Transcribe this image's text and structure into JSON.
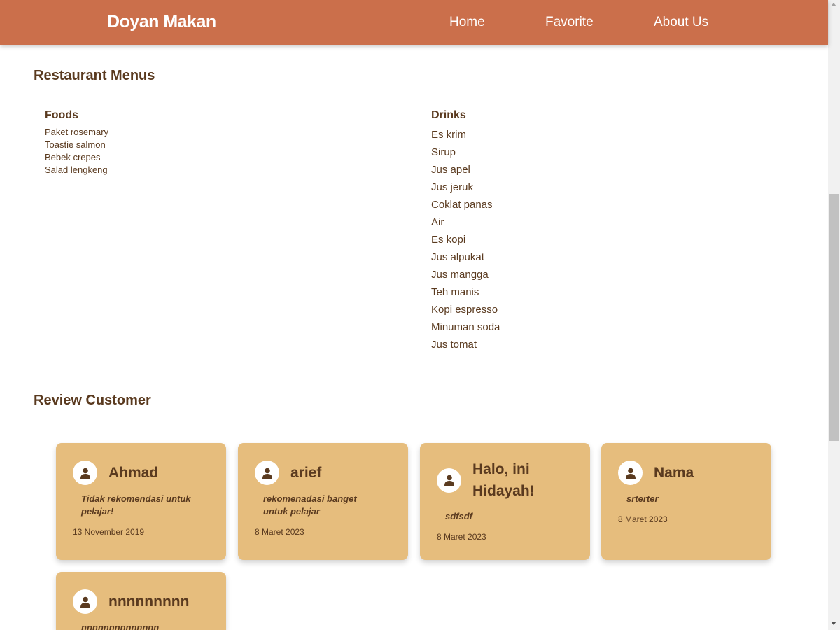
{
  "header": {
    "brand": "Doyan Makan",
    "nav": [
      "Home",
      "Favorite",
      "About Us"
    ]
  },
  "menus": {
    "title": "Restaurant Menus",
    "foods": {
      "heading": "Foods",
      "items": [
        "Paket rosemary",
        "Toastie salmon",
        "Bebek crepes",
        "Salad lengkeng"
      ]
    },
    "drinks": {
      "heading": "Drinks",
      "items": [
        "Es krim",
        "Sirup",
        "Jus apel",
        "Jus jeruk",
        "Coklat panas",
        "Air",
        "Es kopi",
        "Jus alpukat",
        "Jus mangga",
        "Teh manis",
        "Kopi espresso",
        "Minuman soda",
        "Jus tomat"
      ]
    }
  },
  "reviews": {
    "title": "Review Customer",
    "items": [
      {
        "name": "Ahmad",
        "review": "Tidak rekomendasi untuk pelajar!",
        "date": "13 November 2019"
      },
      {
        "name": "arief",
        "review": "rekomenadasi banget untuk pelajar",
        "date": "8 Maret 2023"
      },
      {
        "name": "Halo, ini Hidayah!",
        "review": "sdfsdf",
        "date": "8 Maret 2023"
      },
      {
        "name": "Nama",
        "review": "srterter",
        "date": "8 Maret 2023"
      },
      {
        "name": "nnnnnnnnn",
        "review": "nnnnnnnnnnnnnn",
        "date": ""
      }
    ]
  },
  "colors": {
    "header_bg": "#cb6f4b",
    "card_bg": "#e6bd7d",
    "text_brown": "#5a3a1f"
  },
  "icons": {
    "avatar": "user-icon"
  }
}
